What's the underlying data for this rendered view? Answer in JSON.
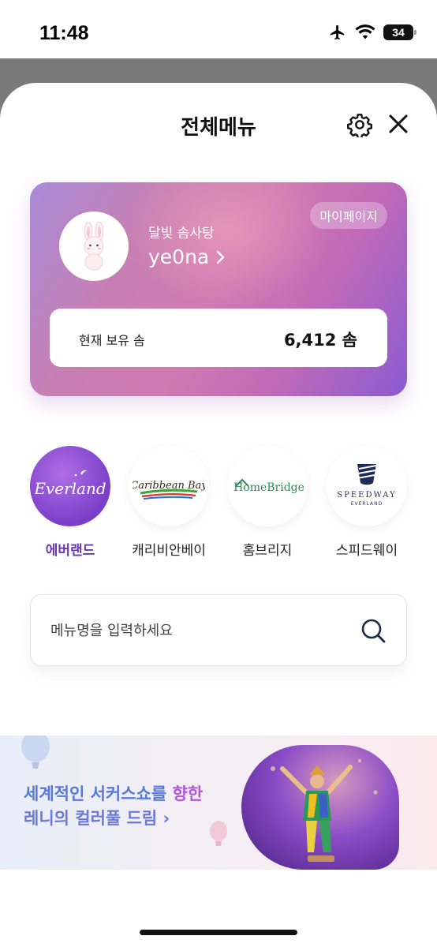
{
  "status_bar": {
    "time": "11:48",
    "battery": "34"
  },
  "sheet": {
    "title": "전체메뉴"
  },
  "profile": {
    "nickname": "달빛 솜사탕",
    "username": "ye0na",
    "mypage_label": "마이페이지",
    "points_label": "현재 보유 솜",
    "points_value": "6,412 솜"
  },
  "brands": [
    {
      "logo_text": "Everland",
      "label": "에버랜드",
      "active": true
    },
    {
      "logo_text": "Caribbean Bay",
      "label": "캐리비안베이",
      "active": false
    },
    {
      "logo_text": "HomeBridge",
      "label": "홈브리지",
      "active": false
    },
    {
      "logo_text": "SPEEDWAY",
      "logo_subtext": "EVERLAND",
      "label": "스피드웨이",
      "active": false
    }
  ],
  "search": {
    "placeholder": "메뉴명을 입력하세요",
    "value": ""
  },
  "banner": {
    "line1_prefix": "세계적인 서커스쇼를 ",
    "line1_highlight": "향한",
    "line2": "레니의 컬러풀 드림 ›"
  },
  "colors": {
    "accent": "#6b35b5",
    "banner_blue": "#5a78d8",
    "banner_purple": "#b05ad8"
  }
}
